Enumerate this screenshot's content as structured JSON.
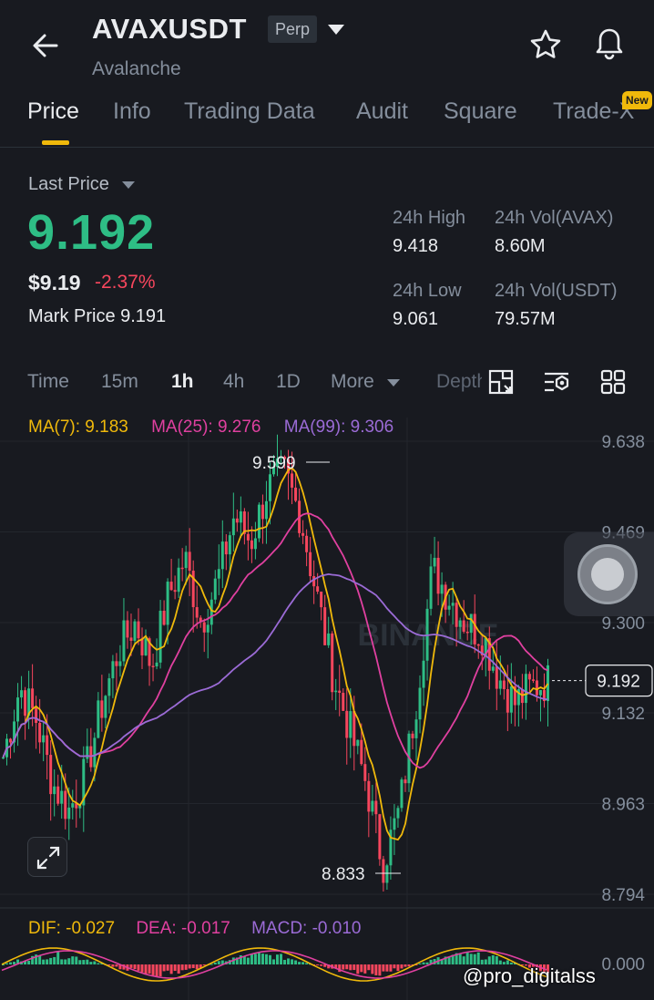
{
  "header": {
    "symbol": "AVAXUSDT",
    "badge": "Perp",
    "name": "Avalanche"
  },
  "tabs": [
    {
      "label": "Price",
      "active": true
    },
    {
      "label": "Info"
    },
    {
      "label": "Trading Data"
    },
    {
      "label": "Audit"
    },
    {
      "label": "Square"
    },
    {
      "label": "Trade-X"
    }
  ],
  "new_badge": "New",
  "price": {
    "last_label": "Last Price",
    "last": "9.192",
    "usd": "$9.19",
    "change": "-2.37%",
    "mark": "Mark Price 9.191"
  },
  "stats": {
    "high_label": "24h High",
    "high": "9.418",
    "vol_avax_label": "24h Vol(AVAX)",
    "vol_avax": "8.60M",
    "low_label": "24h Low",
    "low": "9.061",
    "vol_usdt_label": "24h Vol(USDT)",
    "vol_usdt": "79.57M"
  },
  "intervals": [
    "Time",
    "15m",
    "1h",
    "4h",
    "1D",
    "More",
    "Depth"
  ],
  "active_interval": "1h",
  "icons": [
    "back-arrow-icon",
    "star-icon",
    "bell-icon",
    "compare-icon",
    "indicator-settings-icon",
    "grid-layout-icon",
    "expand-icon"
  ],
  "colors": {
    "up": "#2ebd85",
    "down": "#f6465d",
    "accent": "#f0b90b",
    "ma7": "#f0b90b",
    "ma25": "#e040a0",
    "ma99": "#9b6bd6"
  },
  "ma": {
    "ma7": "MA(7): 9.183",
    "ma25": "MA(25): 9.276",
    "ma99": "MA(99): 9.306"
  },
  "macd": {
    "dif": "DIF: -0.027",
    "dea": "DEA: -0.017",
    "macd": "MACD: -0.010"
  },
  "watermark": "@pro_digitalss",
  "chart_data": {
    "type": "candlestick",
    "y_ticks": [
      "9.638",
      "9.469",
      "9.300",
      "9.132",
      "8.963",
      "8.794"
    ],
    "ylim": [
      8.794,
      9.638
    ],
    "current_price": "9.192",
    "high_annotation": "9.599",
    "low_annotation": "8.833",
    "logo": "BINANCE",
    "macd_zero": "0.000",
    "key_prices": [
      9.05,
      9.18,
      9.12,
      9.0,
      8.95,
      9.02,
      9.15,
      9.25,
      9.3,
      9.22,
      9.35,
      9.42,
      9.3,
      9.38,
      9.5,
      9.45,
      9.55,
      9.58,
      9.5,
      9.35,
      9.2,
      9.1,
      9.0,
      8.85,
      8.95,
      9.15,
      9.4,
      9.35,
      9.3,
      9.28,
      9.2,
      9.15,
      9.18,
      9.19
    ]
  }
}
